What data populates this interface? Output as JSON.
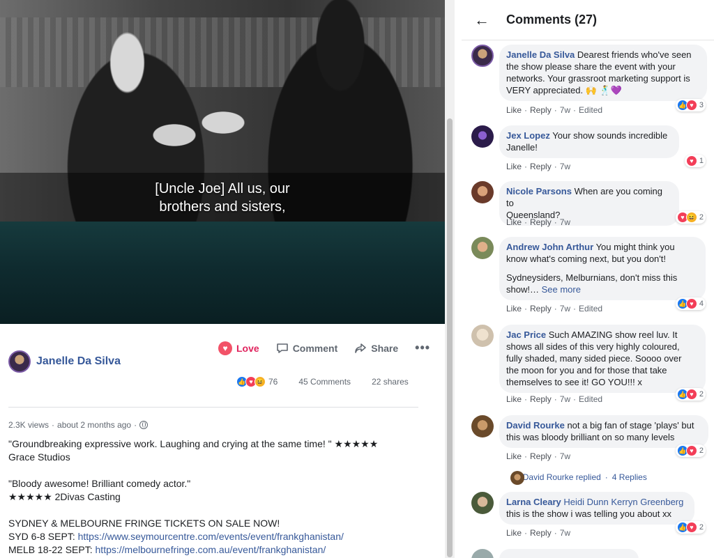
{
  "video": {
    "caption_line1": "[Uncle Joe] All us, our",
    "caption_line2": "brothers and sisters,"
  },
  "post": {
    "author": "Janelle Da Silva",
    "actions": {
      "love": "Love",
      "comment": "Comment",
      "share": "Share",
      "more": "•••"
    },
    "reaction_count": "76",
    "comments_count": "45 Comments",
    "shares_count": "22 shares",
    "views": "2.3K views",
    "time": "about 2 months ago",
    "description": {
      "quote1": "\"Groundbreaking expressive work. Laughing and crying at the same time! \" ★★★★★",
      "quote1_source": "Grace Studios",
      "quote2": "\"Bloody awesome! Brilliant comedy actor.\"",
      "quote2_source": "★★★★★ 2Divas Casting",
      "tickets": "SYDNEY & MELBOURNE FRINGE TICKETS ON SALE NOW!",
      "syd_label": "SYD 6-8 SEPT: ",
      "syd_link": "https://www.seymourcentre.com/events/event/frankghanistan/",
      "melb_label": "MELB 18-22 SEPT: ",
      "melb_link": "https://melbournefringe.com.au/event/frankghanistan/"
    }
  },
  "panel": {
    "title": "Comments (27)",
    "comments": [
      {
        "author": "Janelle Da Silva",
        "text1": "Dearest friends who've seen",
        "text2": "the show please share the event with your",
        "text3": "networks. Your grassroot marketing support is",
        "text4": "VERY appreciated. 🙌 🕺💜",
        "like": "Like",
        "reply": "Reply",
        "age": "7w",
        "edited": "Edited",
        "reaction_count": "3"
      },
      {
        "author": "Jex Lopez",
        "text1": "Your show sounds incredible",
        "text2": "Janelle!",
        "like": "Like",
        "reply": "Reply",
        "age": "7w",
        "reaction_count": "1"
      },
      {
        "author": "Nicole Parsons",
        "text1": "When are you coming to",
        "text2": "Queensland?",
        "like": "Like",
        "reply": "Reply",
        "age": "7w",
        "reaction_count": "2"
      },
      {
        "author": "Andrew John Arthur",
        "text1": "You might think you",
        "text2": "know what's coming next, but you don't!",
        "text3": "Sydneysiders, Melburnians, don't miss this",
        "text4": "show!…",
        "see_more": "See more",
        "like": "Like",
        "reply": "Reply",
        "age": "7w",
        "edited": "Edited",
        "reaction_count": "4"
      },
      {
        "author": "Jac Price",
        "text1": "Such AMAZING show reel luv. It",
        "text2": "shows all sides of this very highly coloured,",
        "text3": "fully shaded, many sided piece. Soooo over",
        "text4": "the moon for you and for those that take",
        "text5": "themselves to see it! GO YOU!!! x",
        "like": "Like",
        "reply": "Reply",
        "age": "7w",
        "edited": "Edited",
        "reaction_count": "2"
      },
      {
        "author": "David Rourke",
        "text1": "not a big fan of stage 'plays' but",
        "text2": "this was bloody brilliant on so many levels",
        "like": "Like",
        "reply": "Reply",
        "age": "7w",
        "reaction_count": "2",
        "replies_author": "David Rourke replied",
        "replies_count": "4 Replies"
      },
      {
        "author": "Larna Cleary",
        "tagged": "Heidi Dunn Kerryn Greenberg",
        "text2": "this is the show i was telling you about xx",
        "like": "Like",
        "reply": "Reply",
        "age": "7w",
        "reaction_count": "2"
      }
    ]
  },
  "colors": {
    "link": "#365899",
    "love": "#e0245e",
    "like": "#1877f2",
    "bubble": "#f2f3f5"
  }
}
